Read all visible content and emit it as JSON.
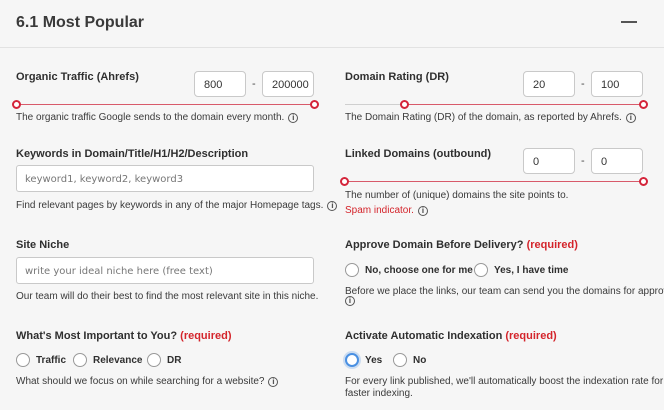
{
  "section": {
    "title": "6.1 Most Popular"
  },
  "organic_traffic": {
    "label": "Organic Traffic (Ahrefs)",
    "min_value": "800",
    "max_value": "200000",
    "range_fraction": [
      0.0,
      1.0
    ],
    "desc": "The organic traffic Google sends to the domain every month."
  },
  "domain_rating": {
    "label": "Domain Rating (DR)",
    "min_value": "20",
    "max_value": "100",
    "range_fraction": [
      0.2,
      1.0
    ],
    "desc": "The Domain Rating (DR) of the domain, as reported by Ahrefs."
  },
  "keywords": {
    "label": "Keywords in Domain/Title/H1/H2/Description",
    "placeholder": "keyword1, keyword2, keyword3",
    "desc": "Find relevant pages by keywords in any of the major Homepage tags."
  },
  "linked_domains": {
    "label": "Linked Domains (outbound)",
    "min_value": "0",
    "max_value": "0",
    "desc": "The number of (unique) domains the site points to.",
    "spam": "Spam indicator."
  },
  "site_niche": {
    "label": "Site Niche",
    "placeholder": "write your ideal niche here (free text)",
    "desc": "Our team will do their best to find the most relevant site in this niche."
  },
  "approve_domain": {
    "label": "Approve Domain Before Delivery?",
    "required": "(required)",
    "options": [
      "No, choose one for me",
      "Yes, I have time"
    ],
    "desc": "Before we place the links, our team can send you the domains for approval."
  },
  "most_important": {
    "label": "What's Most Important to You?",
    "required": "(required)",
    "options": [
      "Traffic",
      "Relevance",
      "DR"
    ],
    "desc": "What should we focus on while searching for a website?"
  },
  "indexation": {
    "label": "Activate Automatic Indexation",
    "required": "(required)",
    "options": [
      "Yes",
      "No"
    ],
    "selected": "Yes",
    "desc_line1": "For every link published, we'll automatically boost the indexation rate for",
    "desc_line2": "faster indexing."
  },
  "colors": {
    "accent_red": "#d4243a",
    "radio_selected": "#4a90e2"
  },
  "icons": {
    "info": "info-icon",
    "collapse": "minus-icon"
  }
}
